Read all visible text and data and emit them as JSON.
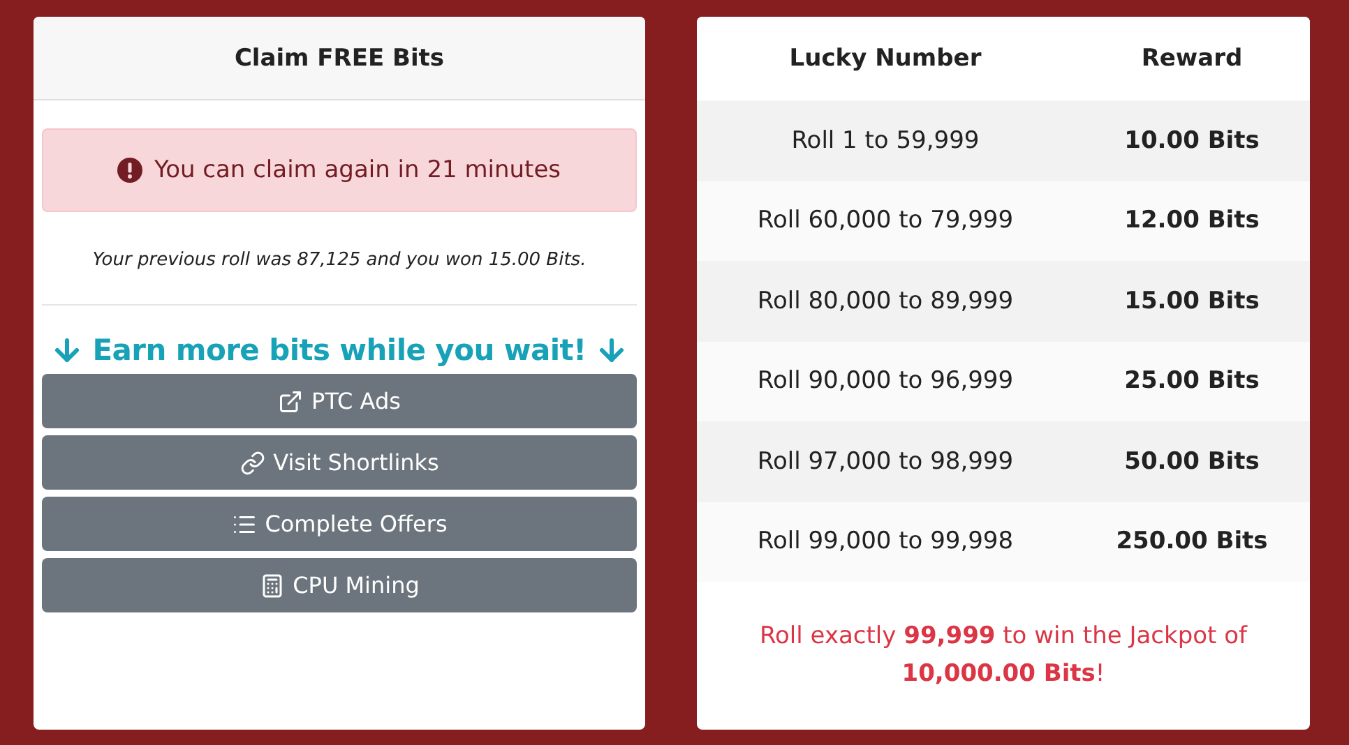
{
  "claim_card": {
    "title": "Claim FREE Bits",
    "alert": "You can claim again in 21 minutes",
    "previous_roll": "Your previous roll was 87,125 and you won 15.00 Bits.",
    "earn_heading": "Earn more bits while you wait!",
    "buttons": [
      {
        "label": "PTC Ads",
        "kind": "external"
      },
      {
        "label": "Visit Shortlinks",
        "kind": "link"
      },
      {
        "label": "Complete Offers",
        "kind": "list"
      },
      {
        "label": "CPU Mining",
        "kind": "calculator"
      }
    ]
  },
  "rewards_table": {
    "columns": [
      "Lucky Number",
      "Reward"
    ],
    "rows": [
      {
        "range": "Roll 1 to 59,999",
        "reward": "10.00 Bits"
      },
      {
        "range": "Roll 60,000 to 79,999",
        "reward": "12.00 Bits"
      },
      {
        "range": "Roll 80,000 to 89,999",
        "reward": "15.00 Bits"
      },
      {
        "range": "Roll 90,000 to 96,999",
        "reward": "25.00 Bits"
      },
      {
        "range": "Roll 97,000 to 98,999",
        "reward": "50.00 Bits"
      },
      {
        "range": "Roll 99,000 to 99,998",
        "reward": "250.00 Bits"
      }
    ],
    "jackpot": "Roll exactly **99,999** to win the Jackpot of **10,000.00 Bits**!"
  }
}
